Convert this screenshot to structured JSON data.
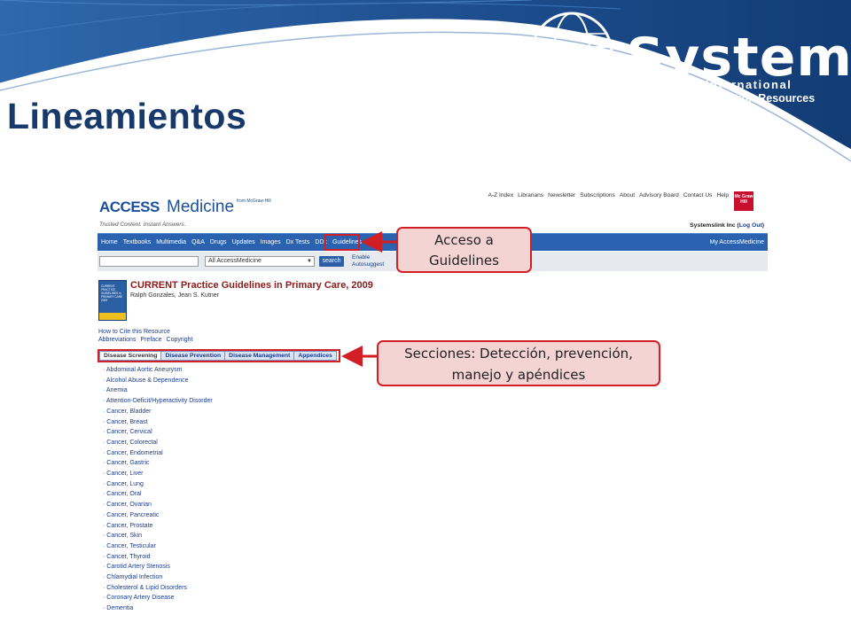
{
  "slide": {
    "title": "Lineamientos",
    "brand": {
      "name": "Systems",
      "line1": "Link International",
      "line2": "Premier Information Resources"
    }
  },
  "site": {
    "logo": {
      "access": "ACCESS",
      "medicine": "Medicine",
      "from": "from McGraw-Hill",
      "tagline": "Trusted Content. Instant Answers."
    },
    "top_links": [
      "A-Z Index",
      "Librarians",
      "Newsletter",
      "Subscriptions",
      "About",
      "Advisory Board",
      "Contact Us",
      "Help"
    ],
    "publisher_logo": "Mc Graw Hill",
    "user": {
      "name": "Systemslink Inc",
      "logout": "Log Out"
    },
    "nav": [
      "Home",
      "Textbooks",
      "Multimedia",
      "Q&A",
      "Drugs",
      "Updates",
      "Images",
      "Dx Tests",
      "DDx",
      "Guidelines",
      "Qui"
    ],
    "nav_right": "My AccessMedicine",
    "search": {
      "query": "",
      "scope": "All AccessMedicine",
      "button": "search",
      "autosuggest": "Enable\nAutosuggest"
    },
    "book": {
      "cover_text": "CURRENT PRACTICE GUIDELINES in PRIMARY CARE 2009",
      "title": "CURRENT Practice Guidelines in Primary Care, 2009",
      "authors": "Ralph Gonzales, Jean S. Kutner"
    },
    "cite": "How to Cite this Resource",
    "meta_links": [
      "Abbreviations",
      "Preface",
      "Copyright"
    ],
    "tabs": [
      "Disease Screening",
      "Disease Prevention",
      "Disease Management",
      "Appendices"
    ],
    "active_tab": "Disease Screening",
    "topics": [
      "Abdominal Aortic Aneurysm",
      "Alcohol Abuse & Dependence",
      "Anemia",
      "Attention-Deficit/Hyperactivity Disorder",
      "Cancer, Bladder",
      "Cancer, Breast",
      "Cancer, Cervical",
      "Cancer, Colorectal",
      "Cancer, Endometrial",
      "Cancer, Gastric",
      "Cancer, Liver",
      "Cancer, Lung",
      "Cancer, Oral",
      "Cancer, Ovarian",
      "Cancer, Pancreatic",
      "Cancer, Prostate",
      "Cancer, Skin",
      "Cancer, Testicular",
      "Cancer, Thyroid",
      "Carotid Artery Stenosis",
      "Chlamydial Infection",
      "Cholesterol & Lipid Disorders",
      "Coronary Artery Disease",
      "Dementia"
    ]
  },
  "annotations": {
    "guidelines": "Acceso a Guidelines",
    "sections": "Secciones: Detección, prevención, manejo y apéndices"
  },
  "colors": {
    "title": "#173a6b",
    "header_blue": "#1e4f8f",
    "nav": "#2a62b0",
    "annotation_red": "#d21f26",
    "callout_fill": "#f4d3d3"
  }
}
